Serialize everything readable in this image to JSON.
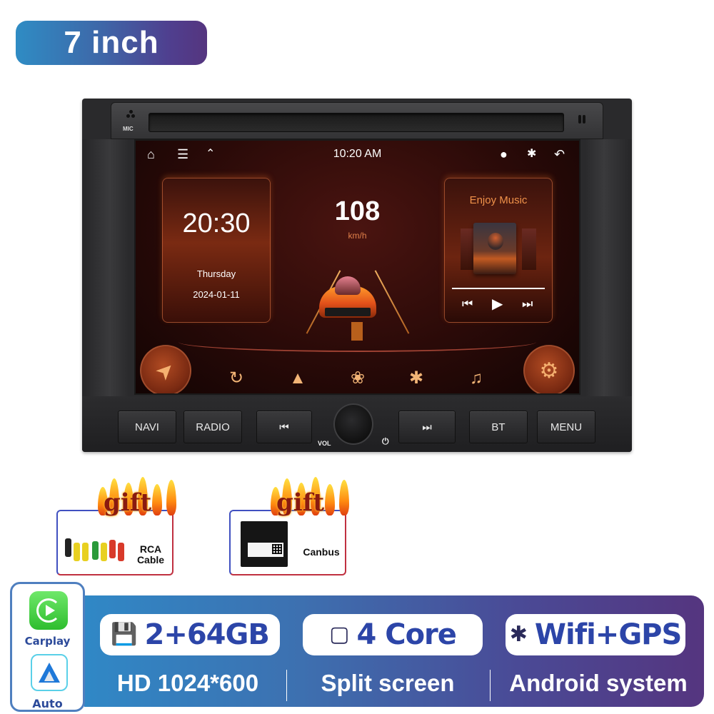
{
  "badge": {
    "size": "7 inch"
  },
  "unit": {
    "mic_label": "MIC",
    "status_bar": {
      "time": "10:20 AM",
      "left_icons": [
        "home-icon",
        "menu-icon",
        "chevrons-up-icon"
      ],
      "right_icons": [
        "location-pin-icon",
        "bluetooth-icon",
        "back-icon"
      ]
    },
    "clock_card": {
      "time": "20:30",
      "day": "Thursday",
      "date": "2024-01-11"
    },
    "speed": {
      "value": "108",
      "unit": "km/h"
    },
    "music_card": {
      "title": "Enjoy Music",
      "progress": 1.0,
      "controls": [
        "previous-icon",
        "play-icon",
        "next-icon"
      ]
    },
    "dock": {
      "left_button": "navigation-arrow-icon",
      "right_button": "settings-gear-icon",
      "apps": [
        "carplay-icon",
        "android-auto-icon",
        "apps-grid-icon",
        "bluetooth-icon",
        "music-note-icon"
      ]
    },
    "hardware_buttons": {
      "navi": "NAVI",
      "radio": "RADIO",
      "prev": "⏮",
      "next": "⏭",
      "bt": "BT",
      "menu": "MENU",
      "vol": "VOL",
      "power": "⏻"
    }
  },
  "gifts": [
    {
      "tag": "gift",
      "label_line1": "RCA",
      "label_line2": "Cable"
    },
    {
      "tag": "gift",
      "label_line1": "Canbus",
      "label_line2": ""
    }
  ],
  "apps_panel": {
    "carplay": "Carplay",
    "auto": "Auto"
  },
  "specs": {
    "memory": "2+64GB",
    "cpu": "4 Core",
    "connectivity": "Wifi+GPS",
    "resolution": "HD 1024*600",
    "feature": "Split screen",
    "system": "Android system"
  }
}
